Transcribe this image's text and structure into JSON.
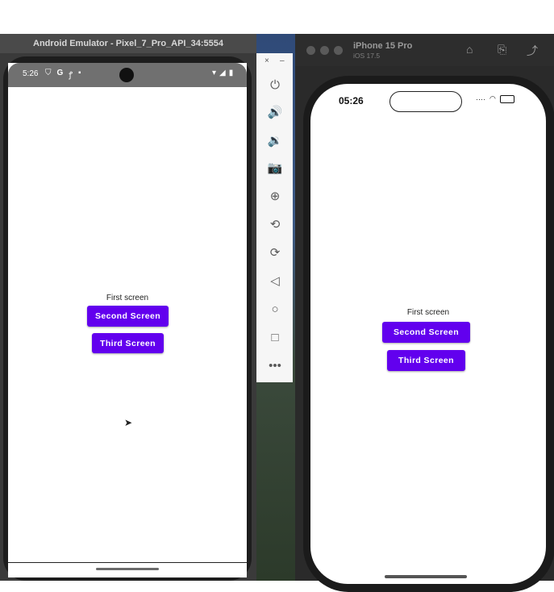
{
  "android": {
    "window_title": "Android Emulator - Pixel_7_Pro_API_34:5554",
    "status_time": "5:26",
    "label": "First screen",
    "button_second": "Second Screen",
    "button_third": "Third Screen"
  },
  "emulator_toolbar": {
    "close": "×",
    "minimize": "–",
    "tools": [
      "power-icon",
      "volume-up-icon",
      "volume-down-icon",
      "camera-icon",
      "zoom-icon",
      "rotate-left-icon",
      "rotate-right-icon",
      "back-icon",
      "home-icon",
      "overview-icon",
      "more-icon"
    ]
  },
  "ios": {
    "device_name": "iPhone 15 Pro",
    "os_version": "iOS 17.5",
    "status_time": "05:26",
    "label": "First screen",
    "button_second": "Second Screen",
    "button_third": "Third Screen"
  },
  "colors": {
    "accent": "#6200ee"
  }
}
